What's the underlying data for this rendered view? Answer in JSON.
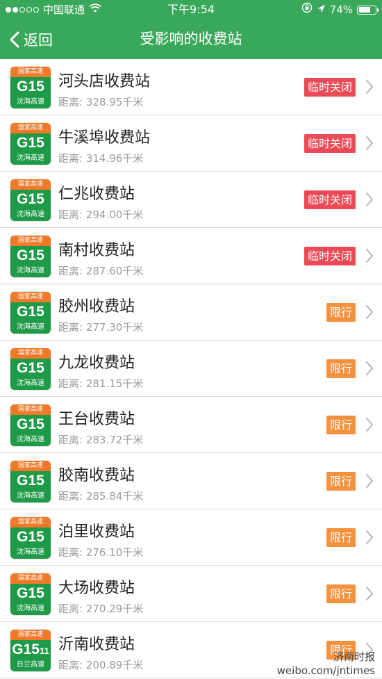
{
  "status_bar": {
    "carrier": "中国联通",
    "time": "下午9:54",
    "battery_text": "74%",
    "battery_level": 0.74
  },
  "nav": {
    "back_label": "返回",
    "title": "受影响的收费站"
  },
  "colors": {
    "brand_green": "#3aa85b",
    "closed_red": "#ea4a55",
    "limit_orange": "#f2913e"
  },
  "stations": [
    {
      "name": "河头店收费站",
      "distance": "距离: 328.95千米",
      "status": "临时关闭",
      "kind": "closed",
      "shield_top": "国家高速",
      "shield_code": "G15",
      "shield_sub": "",
      "shield_name": "沈海高速"
    },
    {
      "name": "牛溪埠收费站",
      "distance": "距离: 314.96千米",
      "status": "临时关闭",
      "kind": "closed",
      "shield_top": "国家高速",
      "shield_code": "G15",
      "shield_sub": "",
      "shield_name": "沈海高速"
    },
    {
      "name": "仁兆收费站",
      "distance": "距离: 294.00千米",
      "status": "临时关闭",
      "kind": "closed",
      "shield_top": "国家高速",
      "shield_code": "G15",
      "shield_sub": "",
      "shield_name": "沈海高速"
    },
    {
      "name": "南村收费站",
      "distance": "距离: 287.60千米",
      "status": "临时关闭",
      "kind": "closed",
      "shield_top": "国家高速",
      "shield_code": "G15",
      "shield_sub": "",
      "shield_name": "沈海高速"
    },
    {
      "name": "胶州收费站",
      "distance": "距离: 277.30千米",
      "status": "限行",
      "kind": "limit",
      "shield_top": "国家高速",
      "shield_code": "G15",
      "shield_sub": "",
      "shield_name": "沈海高速"
    },
    {
      "name": "九龙收费站",
      "distance": "距离: 281.15千米",
      "status": "限行",
      "kind": "limit",
      "shield_top": "国家高速",
      "shield_code": "G15",
      "shield_sub": "",
      "shield_name": "沈海高速"
    },
    {
      "name": "王台收费站",
      "distance": "距离: 283.72千米",
      "status": "限行",
      "kind": "limit",
      "shield_top": "国家高速",
      "shield_code": "G15",
      "shield_sub": "",
      "shield_name": "沈海高速"
    },
    {
      "name": "胶南收费站",
      "distance": "距离: 285.84千米",
      "status": "限行",
      "kind": "limit",
      "shield_top": "国家高速",
      "shield_code": "G15",
      "shield_sub": "",
      "shield_name": "沈海高速"
    },
    {
      "name": "泊里收费站",
      "distance": "距离: 276.10千米",
      "status": "限行",
      "kind": "limit",
      "shield_top": "国家高速",
      "shield_code": "G15",
      "shield_sub": "",
      "shield_name": "沈海高速"
    },
    {
      "name": "大场收费站",
      "distance": "距离: 270.29千米",
      "status": "限行",
      "kind": "limit",
      "shield_top": "国家高速",
      "shield_code": "G15",
      "shield_sub": "",
      "shield_name": "沈海高速"
    },
    {
      "name": "沂南收费站",
      "distance": "距离: 200.89千米",
      "status": "限行",
      "kind": "limit",
      "shield_top": "国家高速",
      "shield_code": "G15",
      "shield_sub": "11",
      "shield_name": "日兰高速"
    }
  ],
  "watermark": {
    "line1": "济南时报",
    "line2": "weibo.com/jntimes"
  }
}
